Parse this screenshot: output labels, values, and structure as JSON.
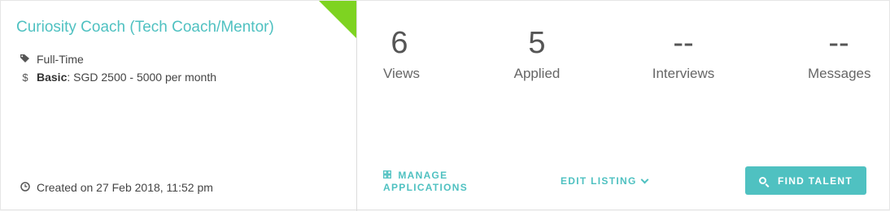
{
  "listing": {
    "title": "Curiosity Coach (Tech Coach/Mentor)",
    "employment_type": "Full-Time",
    "salary_label": "Basic",
    "salary_value": ": SGD 2500 - 5000 per month",
    "created": "Created on 27 Feb 2018, 11:52 pm",
    "status_color": "#7ed321"
  },
  "stats": {
    "views": {
      "value": "6",
      "label": "Views"
    },
    "applied": {
      "value": "5",
      "label": "Applied"
    },
    "interviews": {
      "value": "--",
      "label": "Interviews"
    },
    "messages": {
      "value": "--",
      "label": "Messages"
    }
  },
  "actions": {
    "manage_line1": "MANAGE",
    "manage_line2": "APPLICATIONS",
    "edit": "EDIT LISTING",
    "find_talent": "FIND TALENT"
  },
  "icons": {
    "tag": "tag-icon",
    "dollar": "dollar-icon",
    "clock": "clock-icon",
    "applications": "applications-icon",
    "chevron": "chevron-down-icon",
    "search": "search-icon"
  },
  "colors": {
    "accent": "#4fc1c1"
  }
}
